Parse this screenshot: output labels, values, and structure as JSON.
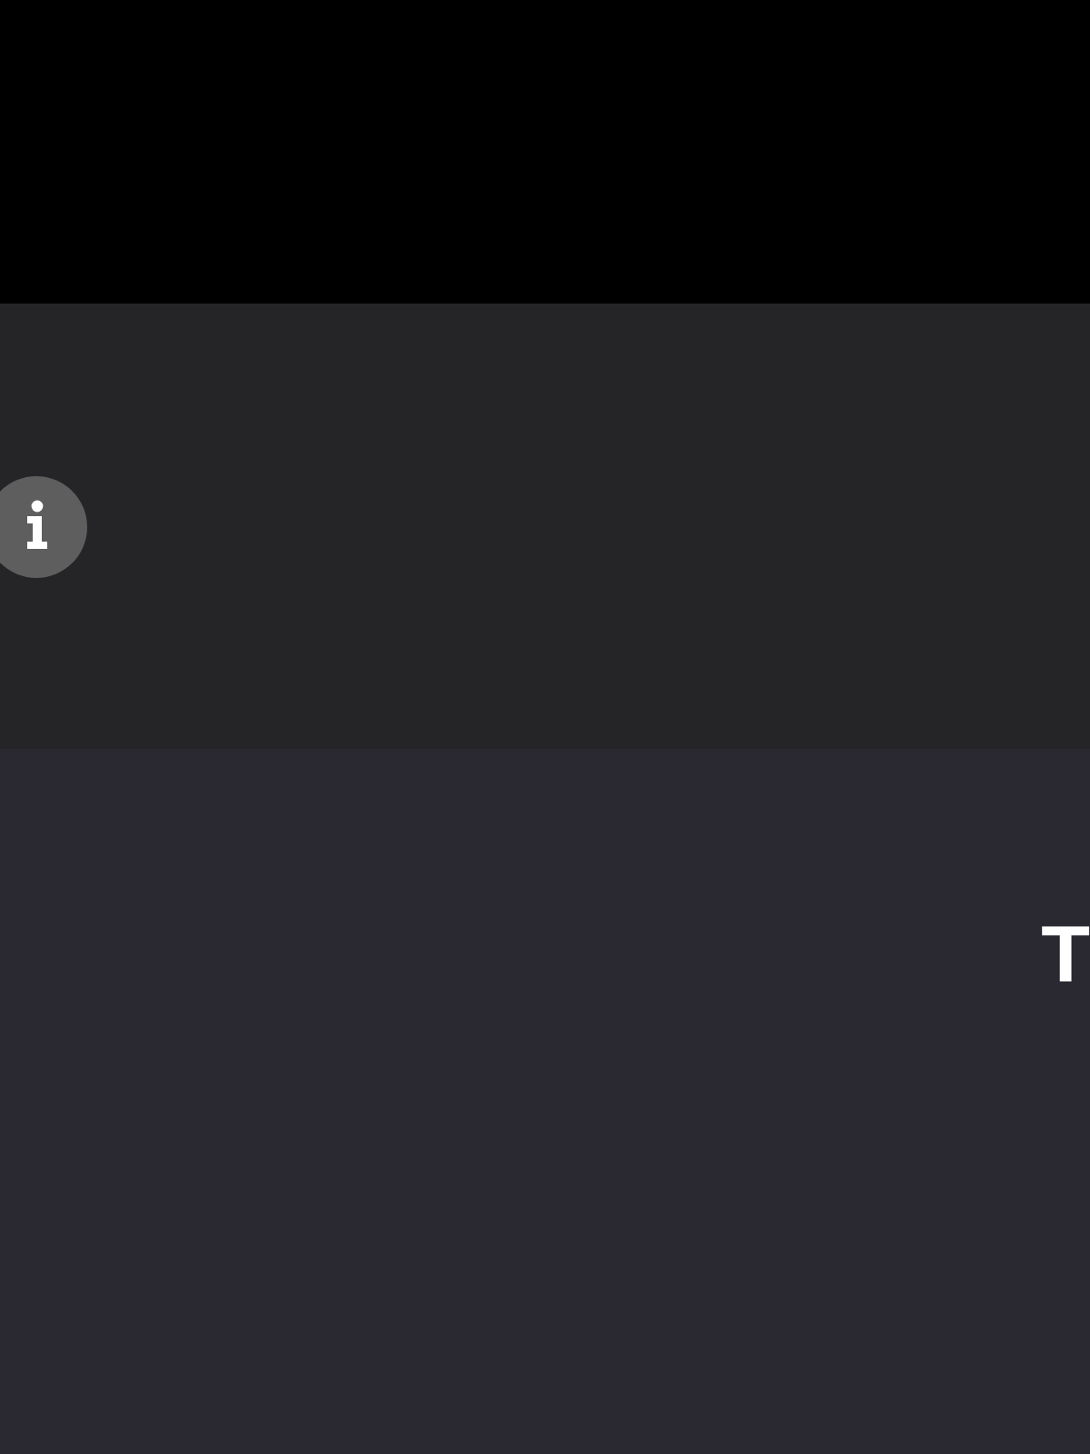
{
  "content": {
    "heading": "T"
  }
}
